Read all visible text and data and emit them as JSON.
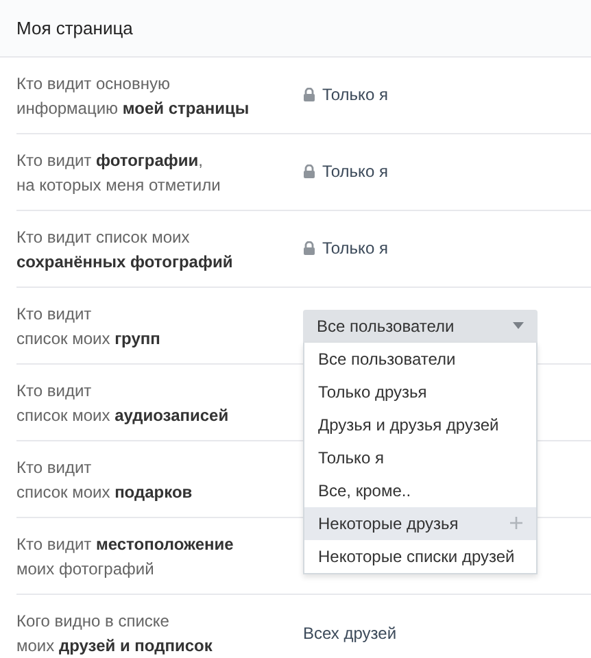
{
  "title": "Моя страница",
  "rows": [
    {
      "label": "Кто видит основную\nинформацию **моей страницы**",
      "kind": "text",
      "locked": true,
      "value": "Только я"
    },
    {
      "label": "Кто видит **фотографии**,\nна которых меня отметили",
      "kind": "text",
      "locked": true,
      "value": "Только я"
    },
    {
      "label": "Кто видит список моих\n**сохранённых фотографий**",
      "kind": "text",
      "locked": true,
      "value": "Только я"
    },
    {
      "label": "Кто видит\nсписок моих **групп**",
      "kind": "dropdown",
      "value": "Все пользователи",
      "expanded": true,
      "options": [
        {
          "label": "Все пользователи",
          "highlighted": false
        },
        {
          "label": "Только друзья",
          "highlighted": false
        },
        {
          "label": "Друзья и друзья друзей",
          "highlighted": false
        },
        {
          "label": "Только я",
          "highlighted": false
        },
        {
          "label": "Все, кроме..",
          "highlighted": false
        },
        {
          "label": "Некоторые друзья",
          "highlighted": true
        },
        {
          "label": "Некоторые списки друзей",
          "highlighted": false
        }
      ]
    },
    {
      "label": "Кто видит\nсписок моих **аудиозаписей**",
      "kind": "hidden"
    },
    {
      "label": "Кто видит\nсписок моих **подарков**",
      "kind": "hidden"
    },
    {
      "label": "Кто видит **местоположение**\nмоих фотографий",
      "kind": "hidden"
    },
    {
      "label": "Кого видно в списке\nмоих **друзей и подписок**",
      "kind": "text",
      "locked": false,
      "value": "Всех друзей"
    }
  ]
}
